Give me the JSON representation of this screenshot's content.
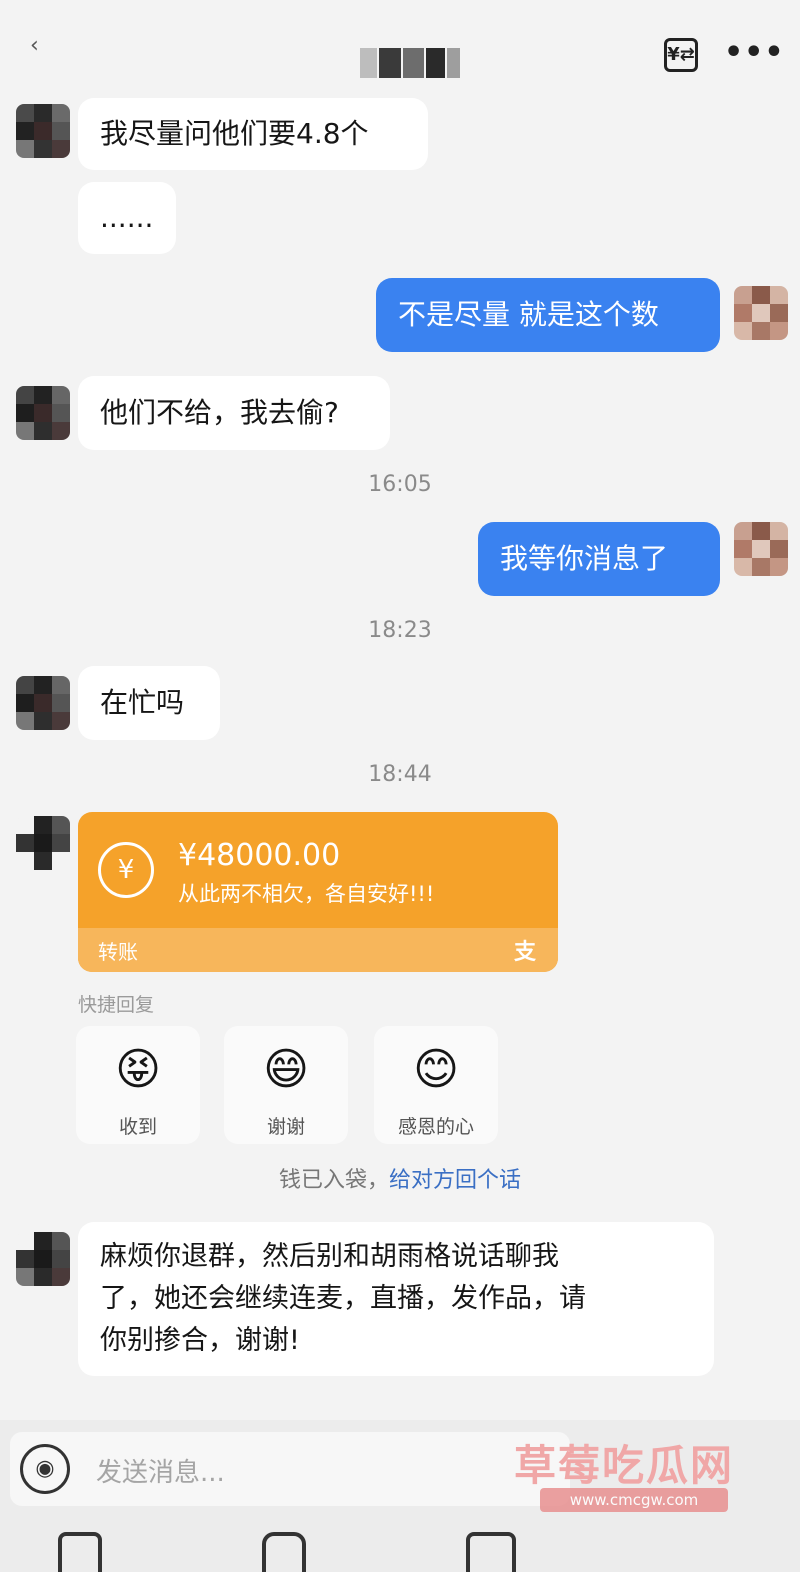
{
  "header": {
    "back_icon": "back-chevron-icon",
    "title_blurred": "",
    "transfer_icon_glyph": "¥⇄",
    "more_glyph": "•••"
  },
  "messages": [
    {
      "side": "left",
      "text": "我尽量问他们要4.8个"
    },
    {
      "side": "left",
      "text": "......"
    },
    {
      "side": "right",
      "text": "不是尽量 就是这个数"
    },
    {
      "side": "left",
      "text": "他们不给，我去偷?"
    },
    {
      "time": "16:05"
    },
    {
      "side": "right",
      "text": "我等你消息了"
    },
    {
      "time": "18:23"
    },
    {
      "side": "left",
      "text": "在忙吗"
    },
    {
      "time": "18:44"
    }
  ],
  "transfer": {
    "amount": "¥48000.00",
    "memo": "从此两不相欠，各自安好!!!",
    "label": "转账",
    "brand_glyph": "支",
    "coin_glyph": "¥",
    "color": "#f5a22a"
  },
  "quick_reply": {
    "title": "快捷回复",
    "options": [
      {
        "label": "收到",
        "emoji": "😝"
      },
      {
        "label": "谢谢",
        "emoji": "😄"
      },
      {
        "label": "感恩的心",
        "emoji": "😊"
      }
    ]
  },
  "tip": {
    "text": "钱已入袋，",
    "link": "给对方回个话"
  },
  "last_message": {
    "line1": "麻烦你退群，然后别和胡雨格说话聊我",
    "line2": "了，她还会继续连麦，直播，发作品，请",
    "line3": "你别掺合，谢谢!"
  },
  "input": {
    "placeholder": "发送消息...",
    "voice_icon": "voice-icon"
  },
  "watermark": {
    "main": "草莓吃瓜网",
    "sub": "www.cmcgw.com"
  },
  "colors": {
    "my_bubble": "#3a82f0",
    "their_bubble": "#ffffff",
    "link": "#3a6fc4"
  }
}
